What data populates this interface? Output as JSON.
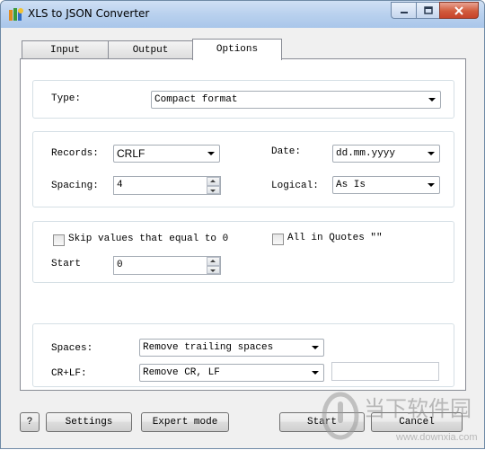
{
  "window": {
    "title": "XLS to JSON Converter"
  },
  "tabs": [
    {
      "label": "Input"
    },
    {
      "label": "Output"
    },
    {
      "label": "Options",
      "active": true
    }
  ],
  "options": {
    "type_label": "Type:",
    "type_value": "Compact format",
    "records_label": "Records:",
    "records_value": "CRLF",
    "date_label": "Date:",
    "date_value": "dd.mm.yyyy",
    "spacing_label": "Spacing:",
    "spacing_value": "4",
    "logical_label": "Logical:",
    "logical_value": "As Is",
    "skip_zero_label": "Skip values that equal to 0",
    "skip_zero_checked": false,
    "all_quotes_label": "All in Quotes \"\"",
    "all_quotes_checked": false,
    "start_label": "Start",
    "start_value": "0",
    "spaces_label": "Spaces:",
    "spaces_value": "Remove trailing spaces",
    "crlf_label": "CR+LF:",
    "crlf_value": "Remove CR, LF",
    "crlf_text": ""
  },
  "buttons": {
    "help": "?",
    "settings": "Settings",
    "expert": "Expert mode",
    "start": "Start",
    "cancel": "Cancel"
  },
  "watermark": {
    "main": "当下软件园",
    "sub": "www.downxia.com"
  },
  "colors": {
    "title_gradient_top": "#cfe0f4",
    "close_button": "#d15b3c",
    "watermark": "#999999"
  }
}
